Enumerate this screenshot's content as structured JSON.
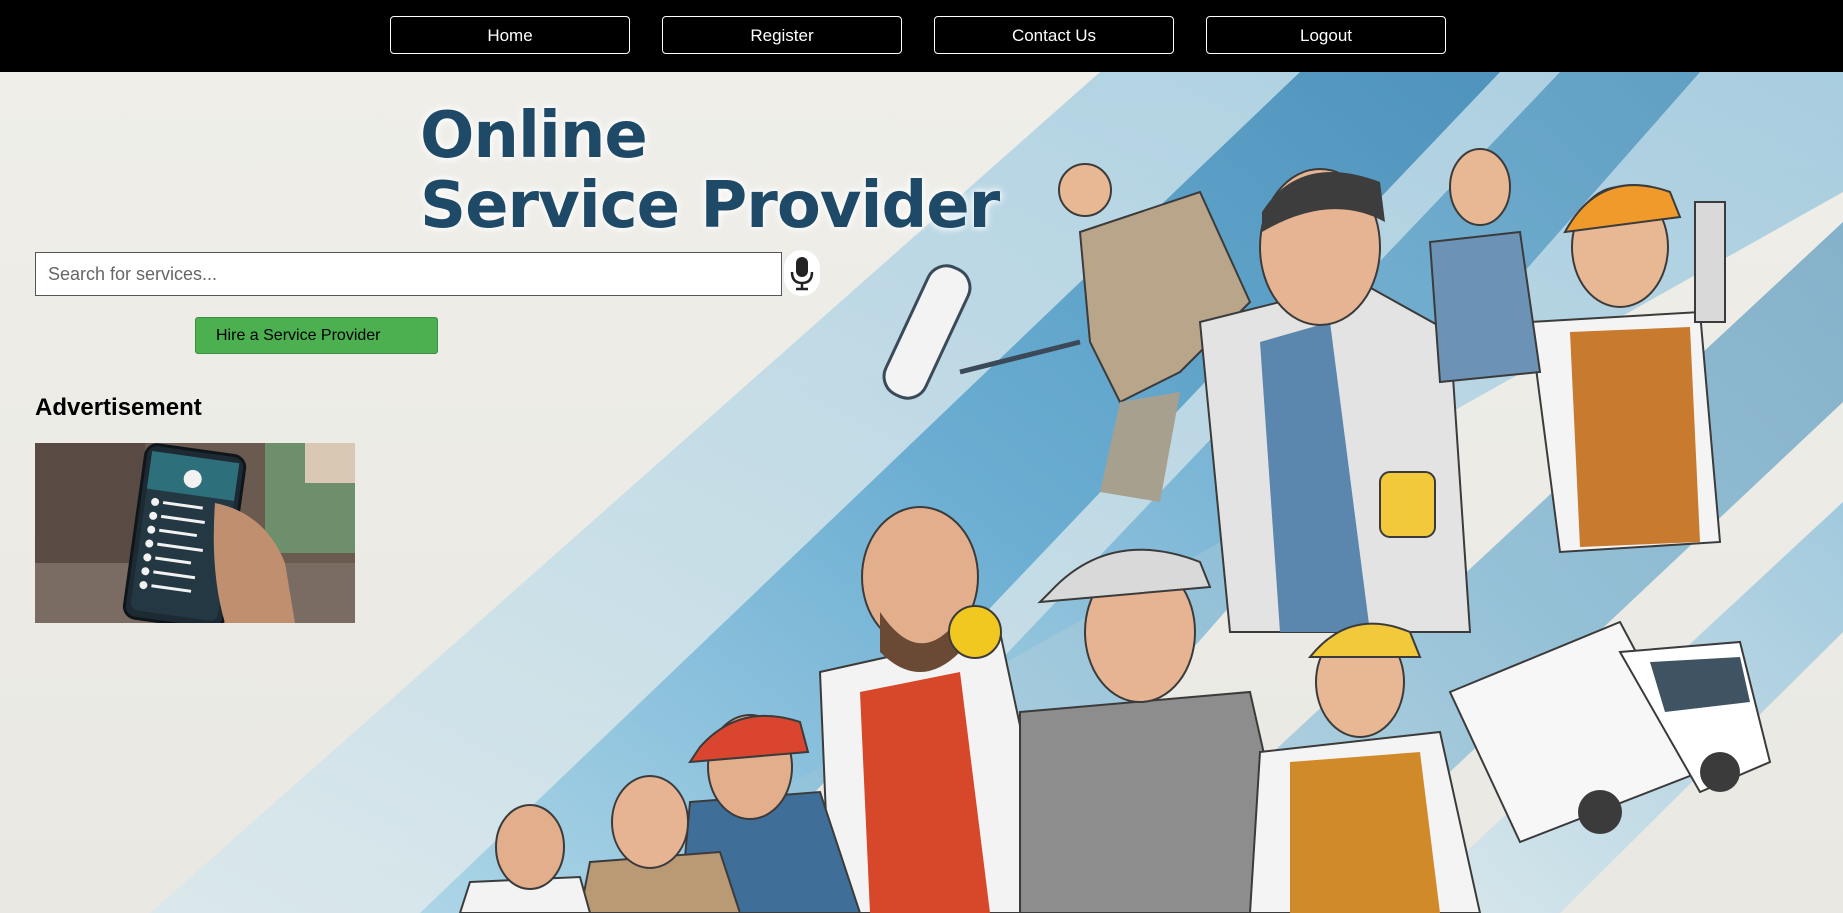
{
  "nav": {
    "home": "Home",
    "register": "Register",
    "contact": "Contact Us",
    "logout": "Logout"
  },
  "hero": {
    "title_line1": "Online",
    "title_line2": "Service Provider"
  },
  "search": {
    "placeholder": "Search for services...",
    "value": ""
  },
  "mic_icon": "microphone-icon",
  "hire_button": "Hire a Service Provider",
  "advertisement": {
    "heading": "Advertisement"
  },
  "colors": {
    "nav_background": "#000000",
    "hire_button": "#4caf50",
    "title": "#1f4a67",
    "accent_blue": "#4f9fcc"
  }
}
